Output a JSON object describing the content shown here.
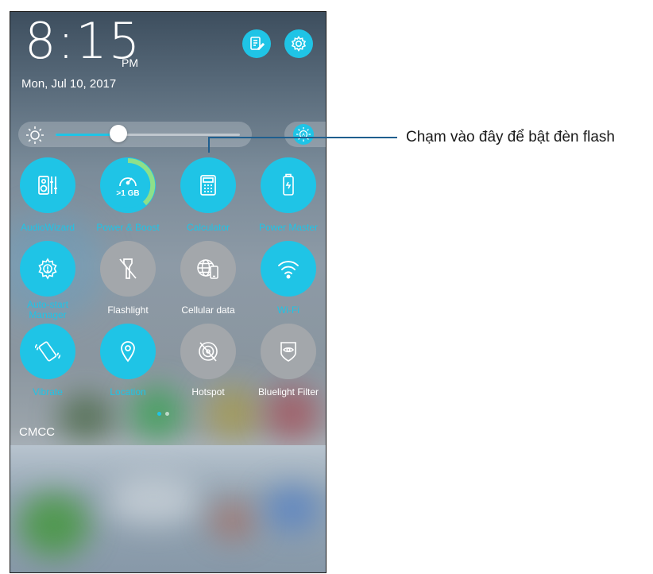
{
  "status": {
    "time": "8:15",
    "ampm": "PM",
    "date": "Mon, Jul 10, 2017"
  },
  "header_buttons": [
    {
      "icon": "notes-edit-icon"
    },
    {
      "icon": "settings-gear-icon"
    }
  ],
  "brightness": {
    "level": 0.34,
    "auto_icon": "auto-brightness-icon"
  },
  "tiles": [
    {
      "label": "AudioWizard",
      "icon": "speaker-eq-icon",
      "state": "on"
    },
    {
      "label": "Power & Boost",
      "icon": "speedometer-icon",
      "state": "on",
      "badge": ">1 GB"
    },
    {
      "label": "Calculator",
      "icon": "calculator-icon",
      "state": "on"
    },
    {
      "label": "Power Master",
      "icon": "battery-icon",
      "state": "on"
    },
    {
      "label": "Auto-start Manager",
      "icon": "gear-shield-icon",
      "state": "on"
    },
    {
      "label": "Flashlight",
      "icon": "flashlight-off-icon",
      "state": "off"
    },
    {
      "label": "Cellular data",
      "icon": "globe-phone-icon",
      "state": "off"
    },
    {
      "label": "Wi-Fi",
      "icon": "wifi-icon",
      "state": "on"
    },
    {
      "label": "Vibrate",
      "icon": "vibrate-icon",
      "state": "on"
    },
    {
      "label": "Location",
      "icon": "location-pin-icon",
      "state": "on"
    },
    {
      "label": "Hotspot",
      "icon": "hotspot-off-icon",
      "state": "off"
    },
    {
      "label": "Bluelight Filter",
      "icon": "eye-filter-icon",
      "state": "off"
    }
  ],
  "carrier": "CMCC",
  "callout": {
    "text": "Chạm vào đây để bật đèn flash"
  },
  "colors": {
    "accent": "#1fc4e6",
    "off": "#a3a7ab",
    "callout_line": "#1f5f8f"
  }
}
